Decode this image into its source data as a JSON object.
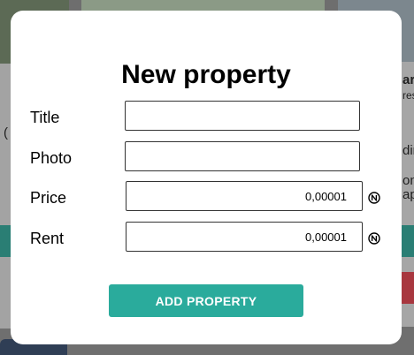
{
  "background": {
    "left_fragment": "(",
    "right_fragments": [
      "ar",
      "res",
      "din",
      "ont",
      "ap"
    ]
  },
  "modal": {
    "title": "New property",
    "fields": [
      {
        "label": "Title",
        "value": ""
      },
      {
        "label": "Photo",
        "value": ""
      },
      {
        "label": "Price",
        "value": "0,00001",
        "currency_icon": "near-coin-icon"
      },
      {
        "label": "Rent",
        "value": "0,00001",
        "currency_icon": "near-coin-icon"
      }
    ],
    "submit_label": "ADD PROPERTY"
  },
  "colors": {
    "accent": "#2aab9c",
    "modal_background": "#ffffff",
    "backdrop": "#6e6e6e"
  }
}
